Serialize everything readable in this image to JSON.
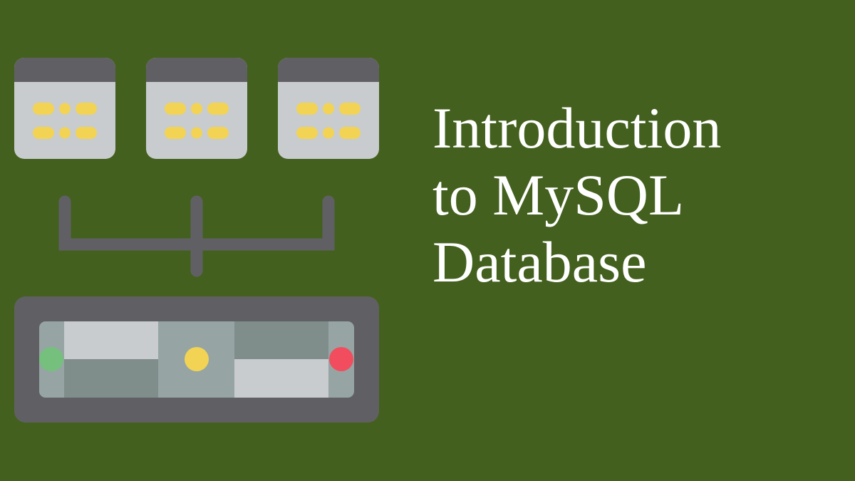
{
  "title": {
    "lines": [
      "Introduction",
      "to MySQL",
      "Database"
    ]
  },
  "illustration": {
    "icon": "database-server-icon",
    "colors": {
      "background": "#43601e",
      "dark_gray": "#606064",
      "light_gray": "#c8ccce",
      "lighter_gray": "#bcc3c5",
      "mid_gray": "#7f8d8b",
      "slate": "#96a5a4",
      "yellow": "#f2d354",
      "green": "#74c07c",
      "red": "#f24d5f"
    }
  }
}
